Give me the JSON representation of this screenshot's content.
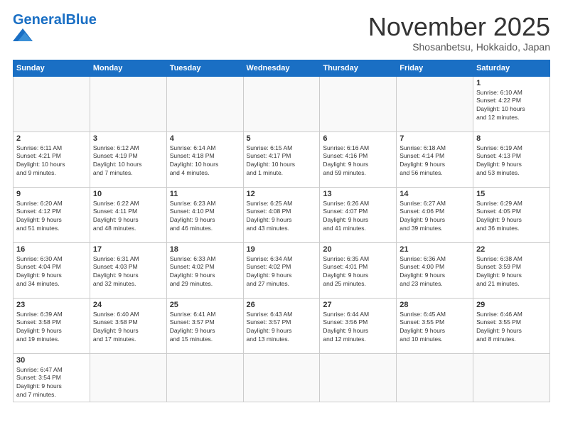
{
  "header": {
    "logo_general": "General",
    "logo_blue": "Blue",
    "title": "November 2025",
    "subtitle": "Shosanbetsu, Hokkaido, Japan"
  },
  "weekdays": [
    "Sunday",
    "Monday",
    "Tuesday",
    "Wednesday",
    "Thursday",
    "Friday",
    "Saturday"
  ],
  "weeks": [
    [
      {
        "day": "",
        "info": ""
      },
      {
        "day": "",
        "info": ""
      },
      {
        "day": "",
        "info": ""
      },
      {
        "day": "",
        "info": ""
      },
      {
        "day": "",
        "info": ""
      },
      {
        "day": "",
        "info": ""
      },
      {
        "day": "1",
        "info": "Sunrise: 6:10 AM\nSunset: 4:22 PM\nDaylight: 10 hours\nand 12 minutes."
      }
    ],
    [
      {
        "day": "2",
        "info": "Sunrise: 6:11 AM\nSunset: 4:21 PM\nDaylight: 10 hours\nand 9 minutes."
      },
      {
        "day": "3",
        "info": "Sunrise: 6:12 AM\nSunset: 4:19 PM\nDaylight: 10 hours\nand 7 minutes."
      },
      {
        "day": "4",
        "info": "Sunrise: 6:14 AM\nSunset: 4:18 PM\nDaylight: 10 hours\nand 4 minutes."
      },
      {
        "day": "5",
        "info": "Sunrise: 6:15 AM\nSunset: 4:17 PM\nDaylight: 10 hours\nand 1 minute."
      },
      {
        "day": "6",
        "info": "Sunrise: 6:16 AM\nSunset: 4:16 PM\nDaylight: 9 hours\nand 59 minutes."
      },
      {
        "day": "7",
        "info": "Sunrise: 6:18 AM\nSunset: 4:14 PM\nDaylight: 9 hours\nand 56 minutes."
      },
      {
        "day": "8",
        "info": "Sunrise: 6:19 AM\nSunset: 4:13 PM\nDaylight: 9 hours\nand 53 minutes."
      }
    ],
    [
      {
        "day": "9",
        "info": "Sunrise: 6:20 AM\nSunset: 4:12 PM\nDaylight: 9 hours\nand 51 minutes."
      },
      {
        "day": "10",
        "info": "Sunrise: 6:22 AM\nSunset: 4:11 PM\nDaylight: 9 hours\nand 48 minutes."
      },
      {
        "day": "11",
        "info": "Sunrise: 6:23 AM\nSunset: 4:10 PM\nDaylight: 9 hours\nand 46 minutes."
      },
      {
        "day": "12",
        "info": "Sunrise: 6:25 AM\nSunset: 4:08 PM\nDaylight: 9 hours\nand 43 minutes."
      },
      {
        "day": "13",
        "info": "Sunrise: 6:26 AM\nSunset: 4:07 PM\nDaylight: 9 hours\nand 41 minutes."
      },
      {
        "day": "14",
        "info": "Sunrise: 6:27 AM\nSunset: 4:06 PM\nDaylight: 9 hours\nand 39 minutes."
      },
      {
        "day": "15",
        "info": "Sunrise: 6:29 AM\nSunset: 4:05 PM\nDaylight: 9 hours\nand 36 minutes."
      }
    ],
    [
      {
        "day": "16",
        "info": "Sunrise: 6:30 AM\nSunset: 4:04 PM\nDaylight: 9 hours\nand 34 minutes."
      },
      {
        "day": "17",
        "info": "Sunrise: 6:31 AM\nSunset: 4:03 PM\nDaylight: 9 hours\nand 32 minutes."
      },
      {
        "day": "18",
        "info": "Sunrise: 6:33 AM\nSunset: 4:02 PM\nDaylight: 9 hours\nand 29 minutes."
      },
      {
        "day": "19",
        "info": "Sunrise: 6:34 AM\nSunset: 4:02 PM\nDaylight: 9 hours\nand 27 minutes."
      },
      {
        "day": "20",
        "info": "Sunrise: 6:35 AM\nSunset: 4:01 PM\nDaylight: 9 hours\nand 25 minutes."
      },
      {
        "day": "21",
        "info": "Sunrise: 6:36 AM\nSunset: 4:00 PM\nDaylight: 9 hours\nand 23 minutes."
      },
      {
        "day": "22",
        "info": "Sunrise: 6:38 AM\nSunset: 3:59 PM\nDaylight: 9 hours\nand 21 minutes."
      }
    ],
    [
      {
        "day": "23",
        "info": "Sunrise: 6:39 AM\nSunset: 3:58 PM\nDaylight: 9 hours\nand 19 minutes."
      },
      {
        "day": "24",
        "info": "Sunrise: 6:40 AM\nSunset: 3:58 PM\nDaylight: 9 hours\nand 17 minutes."
      },
      {
        "day": "25",
        "info": "Sunrise: 6:41 AM\nSunset: 3:57 PM\nDaylight: 9 hours\nand 15 minutes."
      },
      {
        "day": "26",
        "info": "Sunrise: 6:43 AM\nSunset: 3:57 PM\nDaylight: 9 hours\nand 13 minutes."
      },
      {
        "day": "27",
        "info": "Sunrise: 6:44 AM\nSunset: 3:56 PM\nDaylight: 9 hours\nand 12 minutes."
      },
      {
        "day": "28",
        "info": "Sunrise: 6:45 AM\nSunset: 3:55 PM\nDaylight: 9 hours\nand 10 minutes."
      },
      {
        "day": "29",
        "info": "Sunrise: 6:46 AM\nSunset: 3:55 PM\nDaylight: 9 hours\nand 8 minutes."
      }
    ],
    [
      {
        "day": "30",
        "info": "Sunrise: 6:47 AM\nSunset: 3:54 PM\nDaylight: 9 hours\nand 7 minutes."
      },
      {
        "day": "",
        "info": ""
      },
      {
        "day": "",
        "info": ""
      },
      {
        "day": "",
        "info": ""
      },
      {
        "day": "",
        "info": ""
      },
      {
        "day": "",
        "info": ""
      },
      {
        "day": "",
        "info": ""
      }
    ]
  ]
}
